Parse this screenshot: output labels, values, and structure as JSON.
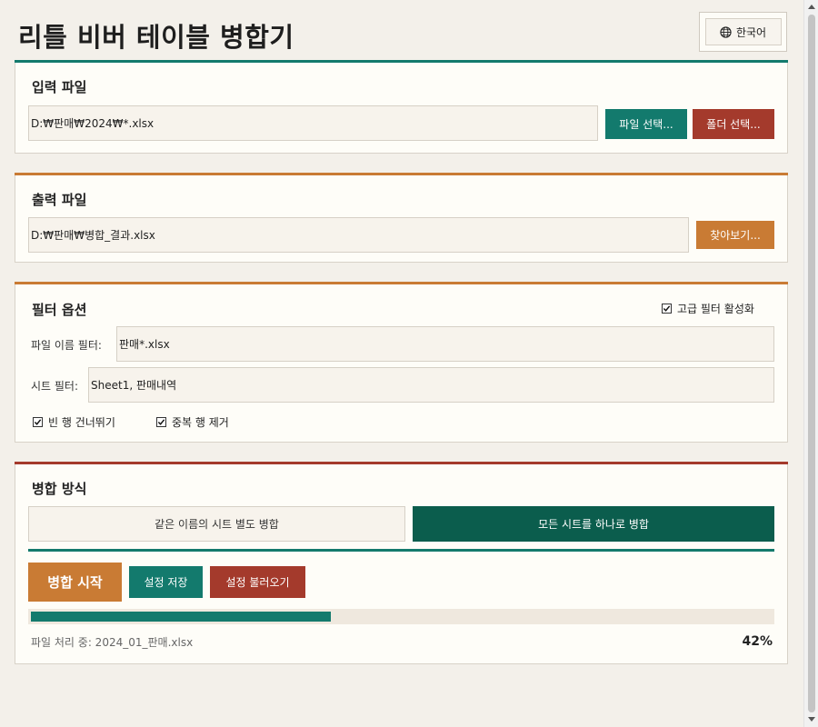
{
  "app": {
    "title": "리틀 비버 테이블 병합기"
  },
  "language": {
    "label": "한국어",
    "icon": "globe-icon"
  },
  "colors": {
    "teal": "#137a6d",
    "rust": "#a43a2c",
    "orange": "#c97b34",
    "dark_teal": "#0b5d4d"
  },
  "input": {
    "title": "입력 파일",
    "value": "D:₩판매₩2024₩*.xlsx",
    "select_file_label": "파일 선택...",
    "select_folder_label": "폴더 선택..."
  },
  "output": {
    "title": "출력 파일",
    "value": "D:₩판매₩병합_결과.xlsx",
    "browse_label": "찾아보기..."
  },
  "filter": {
    "title": "필터 옵션",
    "advanced_label": "고급 필터 활성화",
    "advanced_checked": true,
    "filename_label": "파일 이름 필터:",
    "filename_value": "판매*.xlsx",
    "sheet_label": "시트 필터:",
    "sheet_value": "Sheet1, 판매내역",
    "skip_empty_label": "빈 행 건너뛰기",
    "skip_empty_checked": true,
    "remove_dup_label": "중복 행 제거",
    "remove_dup_checked": true
  },
  "merge": {
    "title": "병합 방식",
    "mode_separate_label": "같은 이름의 시트 별도 병합",
    "mode_all_label": "모든 시트를 하나로 병합",
    "selected_mode": "all",
    "start_label": "병합 시작",
    "save_label": "설정 저장",
    "load_label": "설정 불러오기",
    "progress": 0.42,
    "progress_text": "42%",
    "status_text": "파일 처리 중: 2024_01_판매.xlsx"
  }
}
